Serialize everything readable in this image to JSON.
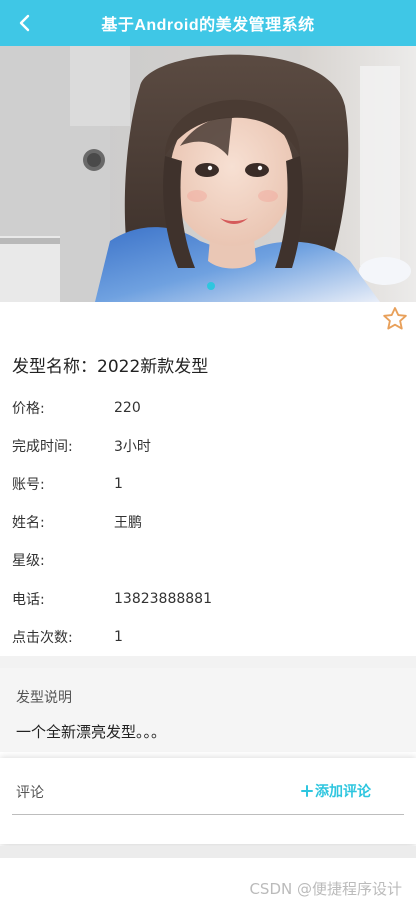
{
  "header": {
    "title": "基于Android的美发管理系统",
    "back_icon": "chevron-left-icon"
  },
  "hero": {
    "carousel_index": 1,
    "carousel_total": 1
  },
  "favorite_icon": "star-outline-icon",
  "style": {
    "name_label": "发型名称：",
    "name_value": "2022新款发型"
  },
  "fields": {
    "price": {
      "label": "价格:",
      "value": "220"
    },
    "duration": {
      "label": "完成时间:",
      "value": "3小时"
    },
    "account": {
      "label": "账号:",
      "value": "1"
    },
    "name": {
      "label": "姓名:",
      "value": "王鹏"
    },
    "level": {
      "label": "星级:",
      "value": ""
    },
    "phone": {
      "label": "电话:",
      "value": "13823888881"
    },
    "clicks": {
      "label": "点击次数:",
      "value": "1"
    }
  },
  "description": {
    "label": "发型说明",
    "text": "一个全新漂亮发型。。。"
  },
  "comments": {
    "label": "评论",
    "add_label": "添加评论"
  },
  "watermark": "CSDN @便捷程序设计",
  "colors": {
    "header": "#3fc7e6",
    "accent": "#2ec6df",
    "star": "#e8a05a"
  }
}
